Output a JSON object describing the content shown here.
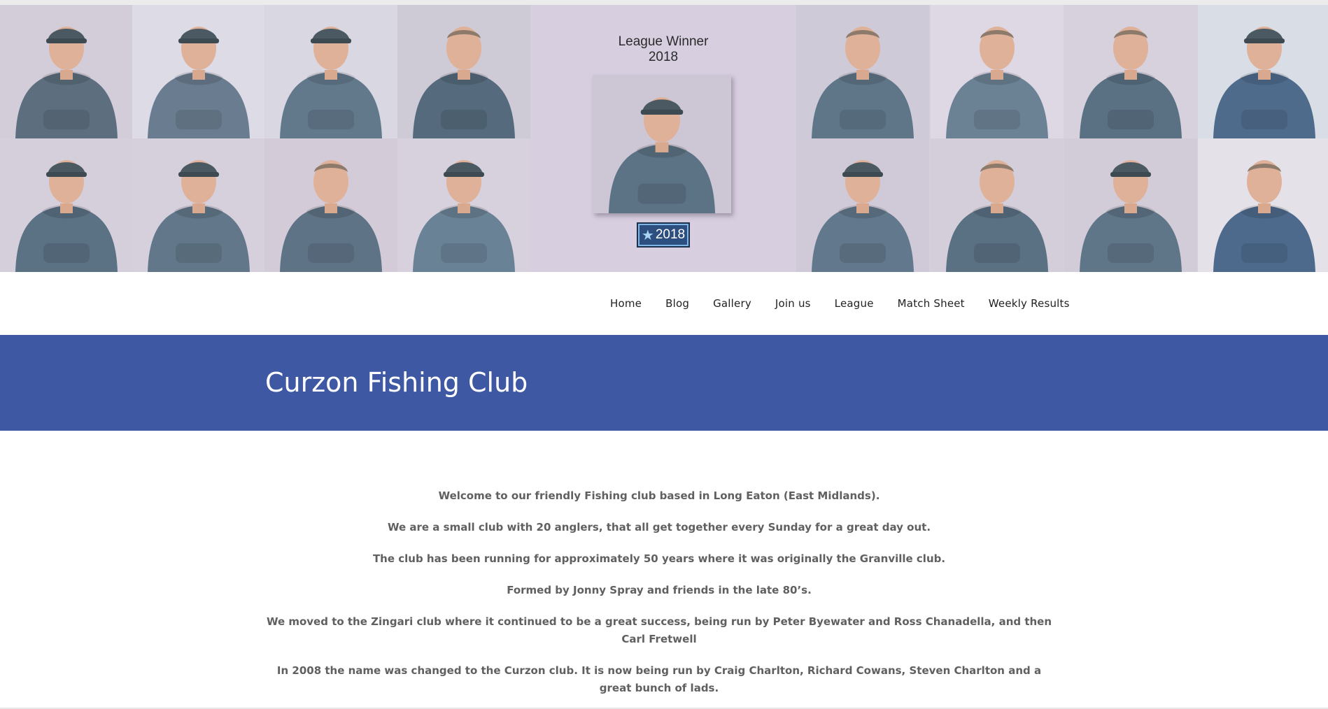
{
  "banner": {
    "winner_title_line1": "League Winner",
    "winner_title_line2": "2018",
    "badge_text": "2018",
    "badge_icon": "star-icon",
    "tiles": [
      {
        "bg": "#d3ccd9",
        "hoodie": "#5d6f7e",
        "cap": true
      },
      {
        "bg": "#dcdbe6",
        "hoodie": "#6a7d90",
        "cap": true
      },
      {
        "bg": "#d9d7e2",
        "hoodie": "#62798c",
        "cap": true
      },
      {
        "bg": "#cfcbd6",
        "hoodie": "#556a7c",
        "cap": false
      },
      {
        "bg": "#cfcad8",
        "hoodie": "#5f7688",
        "cap": false
      },
      {
        "bg": "#ddd8e3",
        "hoodie": "#6b8295",
        "cap": false
      },
      {
        "bg": "#d6d1dd",
        "hoodie": "#5a7083",
        "cap": false
      },
      {
        "bg": "#d9dde6",
        "hoodie": "#4f6b8c",
        "cap": true
      },
      {
        "bg": "#d5cfdc",
        "hoodie": "#5b7184",
        "cap": true
      },
      {
        "bg": "#d6d0dd",
        "hoodie": "#62788a",
        "cap": true
      },
      {
        "bg": "#d3ccd8",
        "hoodie": "#5f7386",
        "cap": false
      },
      {
        "bg": "#d7d1dd",
        "hoodie": "#6a8296",
        "cap": true
      },
      {
        "bg": "#d0c9d7",
        "hoodie": "#62788c",
        "cap": true
      },
      {
        "bg": "#d3ced9",
        "hoodie": "#5a7083",
        "cap": false
      },
      {
        "bg": "#d2ccd8",
        "hoodie": "#5f7588",
        "cap": true
      },
      {
        "bg": "#e4e2e8",
        "hoodie": "#4d6a8d",
        "cap": false
      }
    ],
    "winner_hoodie": "#5c7285"
  },
  "nav": {
    "items": [
      "Home",
      "Blog",
      "Gallery",
      "Join us",
      "League",
      "Match Sheet",
      "Weekly Results"
    ]
  },
  "header": {
    "title": "Curzon Fishing Club",
    "bar_color": "#3f58a3"
  },
  "content": {
    "paragraphs": [
      "Welcome to our friendly Fishing club based in Long Eaton (East Midlands).",
      "We are a small club with 20 anglers, that all get together every Sunday for a great day out.",
      "The club has been running for approximately 50 years where it was originally the Granville club.",
      "Formed by Jonny Spray and friends in the late 80’s.",
      "We moved to the Zingari club where it continued to be a great success, being run by Peter Byewater and Ross Chanadella, and then Carl Fretwell",
      "In 2008 the name was changed to the Curzon club. It is now being run by Craig Charlton, Richard Cowans, Steven Charlton and a great bunch of lads."
    ]
  }
}
